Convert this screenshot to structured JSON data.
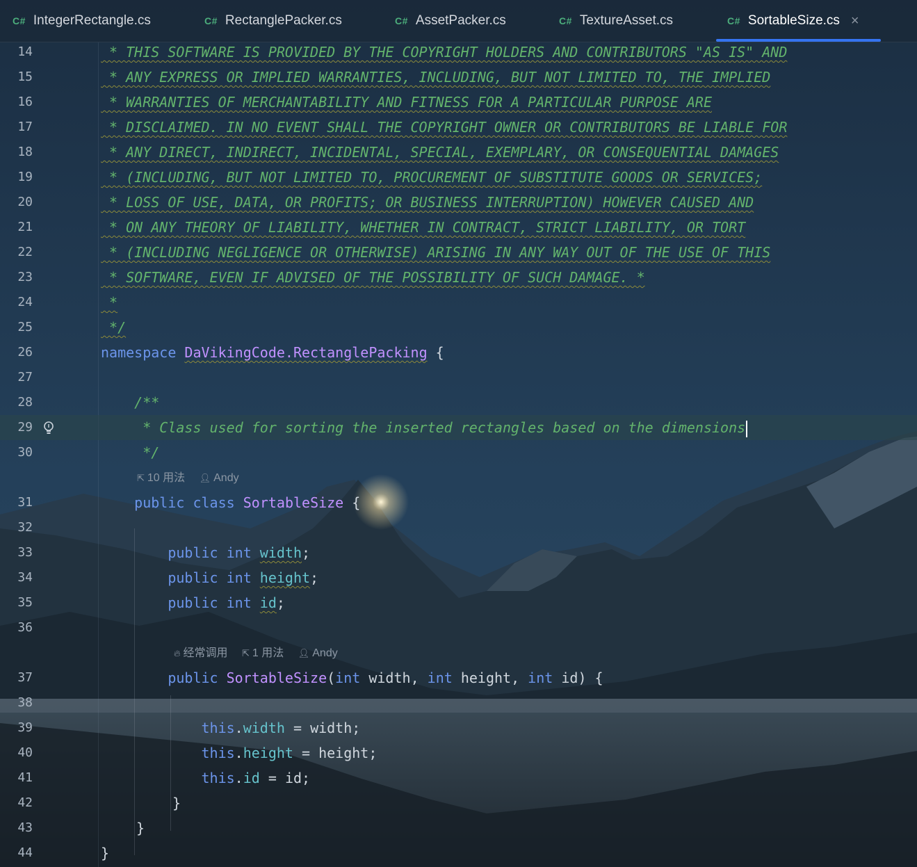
{
  "tabs": [
    {
      "lang": "C#",
      "label": "IntegerRectangle.cs"
    },
    {
      "lang": "C#",
      "label": "RectanglePacker.cs"
    },
    {
      "lang": "C#",
      "label": "AssetPacker.cs"
    },
    {
      "lang": "C#",
      "label": "TextureAsset.cs"
    },
    {
      "lang": "C#",
      "label": "SortableSize.cs",
      "active": true,
      "close": "×"
    }
  ],
  "lines": {
    "14": {
      "n": "14",
      "t": " * THIS SOFTWARE IS PROVIDED BY THE COPYRIGHT HOLDERS AND CONTRIBUTORS \"AS IS\" AND"
    },
    "15": {
      "n": "15",
      "t": " * ANY EXPRESS OR IMPLIED WARRANTIES, INCLUDING, BUT NOT LIMITED TO, THE IMPLIED"
    },
    "16": {
      "n": "16",
      "t": " * WARRANTIES OF MERCHANTABILITY AND FITNESS FOR A PARTICULAR PURPOSE ARE"
    },
    "17": {
      "n": "17",
      "t": " * DISCLAIMED. IN NO EVENT SHALL THE COPYRIGHT OWNER OR CONTRIBUTORS BE LIABLE FOR"
    },
    "18": {
      "n": "18",
      "t": " * ANY DIRECT, INDIRECT, INCIDENTAL, SPECIAL, EXEMPLARY, OR CONSEQUENTIAL DAMAGES"
    },
    "19": {
      "n": "19",
      "t": " * (INCLUDING, BUT NOT LIMITED TO, PROCUREMENT OF SUBSTITUTE GOODS OR SERVICES;"
    },
    "20": {
      "n": "20",
      "t": " * LOSS OF USE, DATA, OR PROFITS; OR BUSINESS INTERRUPTION) HOWEVER CAUSED AND"
    },
    "21": {
      "n": "21",
      "t": " * ON ANY THEORY OF LIABILITY, WHETHER IN CONTRACT, STRICT LIABILITY, OR TORT"
    },
    "22": {
      "n": "22",
      "t": " * (INCLUDING NEGLIGENCE OR OTHERWISE) ARISING IN ANY WAY OUT OF THE USE OF THIS"
    },
    "23": {
      "n": "23",
      "t": " * SOFTWARE, EVEN IF ADVISED OF THE POSSIBILITY OF SUCH DAMAGE. *"
    },
    "24": {
      "n": "24",
      "t": " *"
    },
    "25": {
      "n": "25",
      "t": " */"
    },
    "26": {
      "n": "26",
      "kw": "namespace",
      "ns": "DaVikingCode.RectanglePacking",
      "brace": "{"
    },
    "27": {
      "n": "27"
    },
    "28": {
      "n": "28",
      "t": "    /**"
    },
    "29": {
      "n": "29",
      "t": "     * Class used for sorting the inserted rectangles based on the dimensions"
    },
    "30": {
      "n": "30",
      "t": "     */"
    },
    "31": {
      "n": "31",
      "kw1": "public",
      "kw2": "class",
      "name": "SortableSize",
      "brace": "{"
    },
    "32": {
      "n": "32"
    },
    "33": {
      "n": "33",
      "kw1": "public",
      "kw2": "int",
      "f": "width",
      "end": ";"
    },
    "34": {
      "n": "34",
      "kw1": "public",
      "kw2": "int",
      "f": "height",
      "end": ";"
    },
    "35": {
      "n": "35",
      "kw1": "public",
      "kw2": "int",
      "f": "id",
      "end": ";"
    },
    "36": {
      "n": "36"
    },
    "37": {
      "n": "37",
      "kw1": "public",
      "name": "SortableSize",
      "p1t": "int",
      "p1": "width",
      "p2t": "int",
      "p2": "height",
      "p3t": "int",
      "p3": "id",
      "brace": "{"
    },
    "38": {
      "n": "38"
    },
    "39": {
      "n": "39",
      "this": "this",
      "f": "width",
      "rhs": "width"
    },
    "40": {
      "n": "40",
      "this": "this",
      "f": "height",
      "rhs": "height"
    },
    "41": {
      "n": "41",
      "this": "this",
      "f": "id",
      "rhs": "id"
    },
    "42": {
      "n": "42",
      "t": "}"
    },
    "43": {
      "n": "43",
      "t": "}"
    },
    "44": {
      "n": "44",
      "t": "}"
    }
  },
  "hints": {
    "class": {
      "usages": "10 用法",
      "author": "Andy"
    },
    "ctor": {
      "frequent": "经常调用",
      "usages": "1 用法",
      "author": "Andy"
    }
  },
  "colors": {
    "comment": "#63b36c",
    "keyword": "#6c95eb",
    "type": "#c191ff",
    "field": "#66c3cc",
    "accent": "#3574f0"
  }
}
